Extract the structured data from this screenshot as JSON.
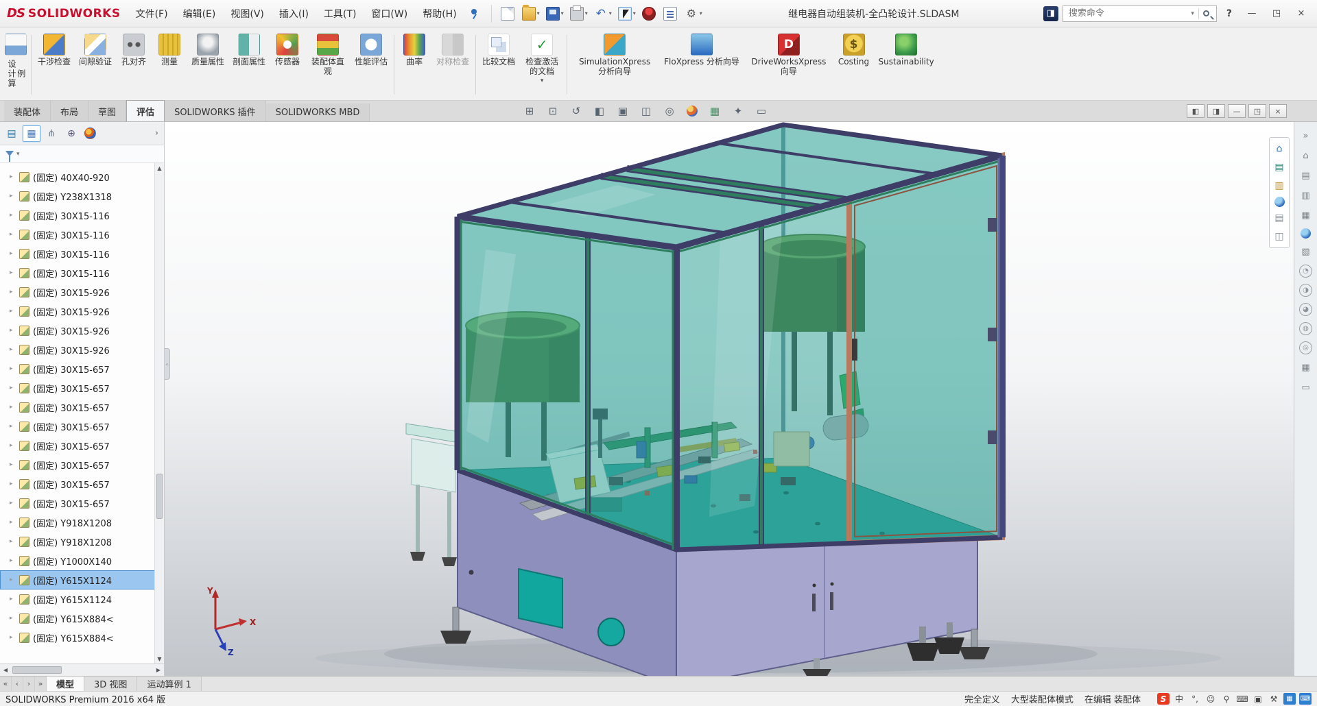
{
  "window": {
    "brand_prefix": "DS",
    "brand": "SOLIDWORKS",
    "title": "继电器自动组装机-全凸轮设计.SLDASM",
    "help_label": "?",
    "controls": {
      "minimize": "—",
      "restore": "◳",
      "close": "×"
    }
  },
  "search": {
    "placeholder": "搜索命令"
  },
  "menubar": {
    "items": [
      {
        "label": "文件(F)"
      },
      {
        "label": "编辑(E)"
      },
      {
        "label": "视图(V)"
      },
      {
        "label": "插入(I)"
      },
      {
        "label": "工具(T)"
      },
      {
        "label": "窗口(W)"
      },
      {
        "label": "帮助(H)"
      }
    ]
  },
  "quickbar": {
    "items": [
      {
        "name": "new-document-button",
        "cls": "qi-new"
      },
      {
        "name": "open-button",
        "cls": "qi-open",
        "caret": "▾"
      },
      {
        "name": "save-button",
        "cls": "qi-save",
        "caret": "▾"
      },
      {
        "name": "print-button",
        "cls": "qi-print",
        "caret": "▾"
      },
      {
        "name": "undo-button",
        "cls": "qi-undo",
        "glyph": "↶",
        "caret": "▾"
      },
      {
        "name": "select-button",
        "cls": "qi-select",
        "caret": "▾"
      },
      {
        "name": "rebuild-button",
        "cls": "qi-rebuild"
      },
      {
        "name": "file-properties-button",
        "cls": "qi-props"
      },
      {
        "name": "options-button",
        "cls": "qi-options",
        "glyph": "⚙",
        "caret": "▾"
      }
    ]
  },
  "ribbon": {
    "items": [
      {
        "name": "design-study-button",
        "label": "设计算例",
        "icon": "ic-study",
        "cls": "vertical"
      },
      {
        "name": "ribbon-separator",
        "cls": "sep"
      },
      {
        "name": "interference-detection-button",
        "label": "干涉检查",
        "icon": "ic-interf"
      },
      {
        "name": "clearance-verification-button",
        "label": "间隙验证",
        "icon": "ic-clear"
      },
      {
        "name": "hole-alignment-button",
        "label": "孔对齐",
        "icon": "ic-hole"
      },
      {
        "name": "measure-button",
        "label": "测量",
        "icon": "ic-measure"
      },
      {
        "name": "mass-properties-button",
        "label": "质量属性",
        "icon": "ic-mass"
      },
      {
        "name": "section-properties-button",
        "label": "剖面属性",
        "icon": "ic-section"
      },
      {
        "name": "sensor-button",
        "label": "传感器",
        "icon": "ic-sensor"
      },
      {
        "name": "assembly-visualization-button",
        "label": "装配体直观",
        "icon": "ic-visual"
      },
      {
        "name": "performance-evaluation-button",
        "label": "性能评估",
        "icon": "ic-perf"
      },
      {
        "name": "ribbon-separator",
        "cls": "sep"
      },
      {
        "name": "curvature-button",
        "label": "曲率",
        "icon": "ic-curv"
      },
      {
        "name": "symmetry-check-button",
        "label": "对称检查",
        "icon": "ic-symm",
        "cls": "disabled"
      },
      {
        "name": "ribbon-separator",
        "cls": "sep"
      },
      {
        "name": "compare-documents-button",
        "label": "比较文档",
        "icon": "ic-compare"
      },
      {
        "name": "check-active-document-button",
        "label": "检查激活的文档",
        "icon": "ic-checkdoc",
        "caret": "▾"
      },
      {
        "name": "ribbon-separator",
        "cls": "sep"
      },
      {
        "name": "simulationxpress-wizard-button",
        "label": "SimulationXpress 分析向导",
        "icon": "ic-simx",
        "cls": "wide"
      },
      {
        "name": "floxpress-wizard-button",
        "label": "FloXpress 分析向导",
        "icon": "ic-flox",
        "cls": "wide"
      },
      {
        "name": "driveworksxpress-wizard-button",
        "label": "DriveWorksXpress 向导",
        "icon": "ic-dwx",
        "cls": "wide"
      },
      {
        "name": "costing-button",
        "label": "Costing",
        "icon": "ic-cost"
      },
      {
        "name": "sustainability-button",
        "label": "Sustainability",
        "icon": "ic-sust",
        "cls": "wide"
      }
    ]
  },
  "command_tabs": {
    "items": [
      {
        "label": "装配体"
      },
      {
        "label": "布局"
      },
      {
        "label": "草图"
      },
      {
        "label": "评估",
        "cls": "active"
      },
      {
        "label": "SOLIDWORKS 插件"
      },
      {
        "label": "SOLIDWORKS MBD"
      }
    ]
  },
  "feature_panel": {
    "tabs": [
      {
        "name": "featuremanager-tab",
        "glyph": "▤",
        "cls": "pt-c1"
      },
      {
        "name": "propertymanager-tab",
        "glyph": "▦",
        "cls": "pt-c2 active"
      },
      {
        "name": "configurationmanager-tab",
        "glyph": "⋔",
        "cls": "pt-c3"
      },
      {
        "name": "dimxpertmanager-tab",
        "glyph": "⊕",
        "cls": "pt-c4"
      },
      {
        "name": "displaymanager-tab",
        "glyph": "●",
        "cls": "pt-ball"
      }
    ],
    "chevron": "›",
    "tree": {
      "items": [
        {
          "label": "(固定) 40X40-920"
        },
        {
          "label": "(固定) Y238X1318"
        },
        {
          "label": "(固定) 30X15-116"
        },
        {
          "label": "(固定) 30X15-116"
        },
        {
          "label": "(固定) 30X15-116"
        },
        {
          "label": "(固定) 30X15-116"
        },
        {
          "label": "(固定) 30X15-926"
        },
        {
          "label": "(固定) 30X15-926"
        },
        {
          "label": "(固定) 30X15-926"
        },
        {
          "label": "(固定) 30X15-926"
        },
        {
          "label": "(固定) 30X15-657"
        },
        {
          "label": "(固定) 30X15-657"
        },
        {
          "label": "(固定) 30X15-657"
        },
        {
          "label": "(固定) 30X15-657"
        },
        {
          "label": "(固定) 30X15-657"
        },
        {
          "label": "(固定) 30X15-657"
        },
        {
          "label": "(固定) 30X15-657"
        },
        {
          "label": "(固定) 30X15-657"
        },
        {
          "label": "(固定) Y918X1208"
        },
        {
          "label": "(固定) Y918X1208"
        },
        {
          "label": "(固定) Y1000X140"
        },
        {
          "label": "(固定) Y615X1124",
          "cls": "selected"
        },
        {
          "label": "(固定) Y615X1124"
        },
        {
          "label": "(固定) Y615X884<"
        },
        {
          "label": "(固定) Y615X884<"
        }
      ]
    }
  },
  "viewport": {
    "heads_up": [
      {
        "name": "zoom-fit-icon",
        "glyph": "⊞"
      },
      {
        "name": "zoom-area-icon",
        "glyph": "⊡"
      },
      {
        "name": "previous-view-icon",
        "glyph": "↺"
      },
      {
        "name": "section-view-icon",
        "glyph": "◧"
      },
      {
        "name": "view-orientation-icon",
        "glyph": "▣"
      },
      {
        "name": "display-style-icon",
        "glyph": "◫"
      },
      {
        "name": "hide-show-items-icon",
        "glyph": "◎"
      },
      {
        "name": "edit-appearance-icon",
        "glyph": "●",
        "cls": "hu-color"
      },
      {
        "name": "apply-scene-icon",
        "glyph": "▦",
        "cls": "hu-scene"
      },
      {
        "name": "view-settings-icon",
        "glyph": "✦"
      },
      {
        "name": "full-screen-icon",
        "glyph": "▭"
      }
    ],
    "window_controls": [
      {
        "name": "viewport-split-left-icon",
        "glyph": "◧"
      },
      {
        "name": "viewport-split-right-icon",
        "glyph": "◨"
      },
      {
        "name": "document-minimize-button",
        "glyph": "—"
      },
      {
        "name": "document-restore-button",
        "glyph": "◳"
      },
      {
        "name": "document-close-button",
        "glyph": "×"
      }
    ],
    "right_toolbar": [
      {
        "name": "home-icon",
        "glyph": "⌂",
        "cls": "ri-blue"
      },
      {
        "name": "design-library-icon",
        "glyph": "▤",
        "cls": "ri-teal"
      },
      {
        "name": "file-explorer-icon",
        "glyph": "▥",
        "cls": "ri-amber"
      },
      {
        "name": "appearances-icon",
        "glyph": "●",
        "cls": "ri-ball"
      },
      {
        "name": "custom-properties-icon",
        "glyph": "▤",
        "cls": "ri-gray"
      },
      {
        "name": "pane-window-icon",
        "glyph": "◫",
        "cls": "ri-gray"
      }
    ],
    "triad": {
      "x_label": "X",
      "y_label": "Y",
      "z_label": "Z"
    },
    "model_colors": {
      "glass": "#2ba196",
      "frame": "#3d3d68",
      "accent_green": "#2f7d5f",
      "door_frame": "#b87a5e",
      "cabinet": "#8f8fbe",
      "table": "#2fa39a",
      "feeder_green": "#4f7c3c"
    }
  },
  "task_pane": {
    "items": [
      {
        "name": "collapse-icon",
        "glyph": "»"
      },
      {
        "name": "resources-icon",
        "glyph": "⌂"
      },
      {
        "name": "library-icon",
        "glyph": "▤"
      },
      {
        "name": "explorer-icon",
        "glyph": "▥"
      },
      {
        "name": "view-palette-icon",
        "glyph": "▦"
      },
      {
        "name": "appearances-scenes-icon",
        "glyph": "●",
        "cls": "tp-ball"
      },
      {
        "name": "custom-properties-icon",
        "glyph": "▧"
      },
      {
        "name": "pane-tool-icon",
        "glyph": "◔",
        "cls": "tp-circle"
      },
      {
        "name": "pane-tool-icon",
        "glyph": "◑",
        "cls": "tp-circle"
      },
      {
        "name": "pane-tool-icon",
        "glyph": "◕",
        "cls": "tp-circle"
      },
      {
        "name": "pane-tool-icon",
        "glyph": "◍",
        "cls": "tp-circle"
      },
      {
        "name": "pane-tool-icon",
        "glyph": "◎",
        "cls": "tp-circle"
      },
      {
        "name": "grid-icon",
        "glyph": "▦"
      },
      {
        "name": "screen-icon",
        "glyph": "▭"
      }
    ]
  },
  "doc_tabs": {
    "nav": [
      {
        "name": "tab-scroll-first-icon",
        "glyph": "«"
      },
      {
        "name": "tab-scroll-prev-icon",
        "glyph": "‹"
      },
      {
        "name": "tab-scroll-next-icon",
        "glyph": "›"
      },
      {
        "name": "tab-scroll-last-icon",
        "glyph": "»"
      }
    ],
    "items": [
      {
        "label": "模型",
        "cls": "active"
      },
      {
        "label": "3D 视图"
      },
      {
        "label": "运动算例 1"
      }
    ]
  },
  "status_bar": {
    "left": "SOLIDWORKS Premium 2016 x64 版",
    "items": [
      {
        "label": "完全定义"
      },
      {
        "label": "大型装配体模式"
      },
      {
        "label": "在编辑 装配体"
      }
    ],
    "tray": [
      {
        "name": "sogou-icon",
        "glyph": "S",
        "cls": "tr-sogou"
      },
      {
        "name": "ime-mode-icon",
        "glyph": "中",
        "cls": "tr-plain"
      },
      {
        "name": "ime-punctuation-icon",
        "glyph": "°,",
        "cls": "tr-plain"
      },
      {
        "name": "ime-emoji-icon",
        "glyph": "☺",
        "cls": "tr-plain"
      },
      {
        "name": "ime-mic-icon",
        "glyph": "⚲",
        "cls": "tr-plain"
      },
      {
        "name": "ime-keyboard-icon",
        "glyph": "⌨",
        "cls": "tr-plain"
      },
      {
        "name": "ime-screenshot-icon",
        "glyph": "▣",
        "cls": "tr-plain"
      },
      {
        "name": "ime-toolbox-icon",
        "glyph": "⚒",
        "cls": "tr-plain"
      },
      {
        "name": "tray-panel-icon",
        "glyph": "▦",
        "cls": "tr-blue"
      },
      {
        "name": "touch-keyboard-icon",
        "glyph": "⌨",
        "cls": "tr-blue"
      }
    ]
  }
}
